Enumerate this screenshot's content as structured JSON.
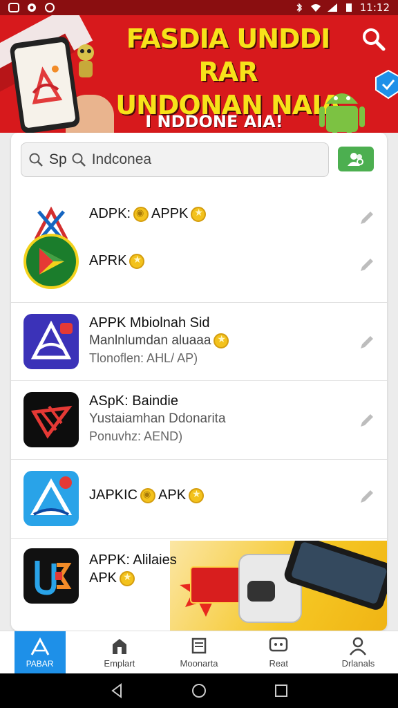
{
  "status_bar": {
    "time": "11:12",
    "icons": [
      "app-icon",
      "record-icon",
      "wifi-small-icon",
      "bluetooth-icon",
      "wifi-icon",
      "signal-icon",
      "battery-icon"
    ]
  },
  "banner": {
    "title_line1": "FASDIA UNDDI RAR",
    "title_line2": "UNDONAN NAIA",
    "subtitle": "I NDDONE AIA!",
    "colors": {
      "background": "#d7191c",
      "title": "#f7e21a"
    }
  },
  "search": {
    "value_prefix": "Sp",
    "value": "Indconea",
    "action_icon": "people-icon"
  },
  "apps": [
    {
      "name": "ADPK:",
      "badge1": "coin-icon",
      "name2": "APPK",
      "badge2": "star-coin-icon"
    },
    {
      "name": "APRK",
      "badge": "star-coin-icon"
    },
    {
      "name": "APPK Mbiolnah Sid",
      "desc": "Manlnlumdan aluaaa",
      "meta": "Tlonoflen: AHL/ AP)"
    },
    {
      "name": "ASpK: Baindie",
      "desc": "Yustaiamhan Ddonarita",
      "meta": "Ponuvhz: AEND)"
    },
    {
      "name": "JAPKIC",
      "name2": "APK"
    },
    {
      "name": "APPK: Alilaies",
      "desc": "APK"
    }
  ],
  "bottom_nav": [
    {
      "label": "PABAR",
      "icon": "home-apps-icon",
      "active": true
    },
    {
      "label": "Emplart",
      "icon": "house-icon"
    },
    {
      "label": "Moonarta",
      "icon": "stack-icon"
    },
    {
      "label": "Reat",
      "icon": "chat-icon"
    },
    {
      "label": "Drlanals",
      "icon": "person-icon"
    }
  ],
  "accent": "#1e90e8",
  "green": "#4caf50"
}
